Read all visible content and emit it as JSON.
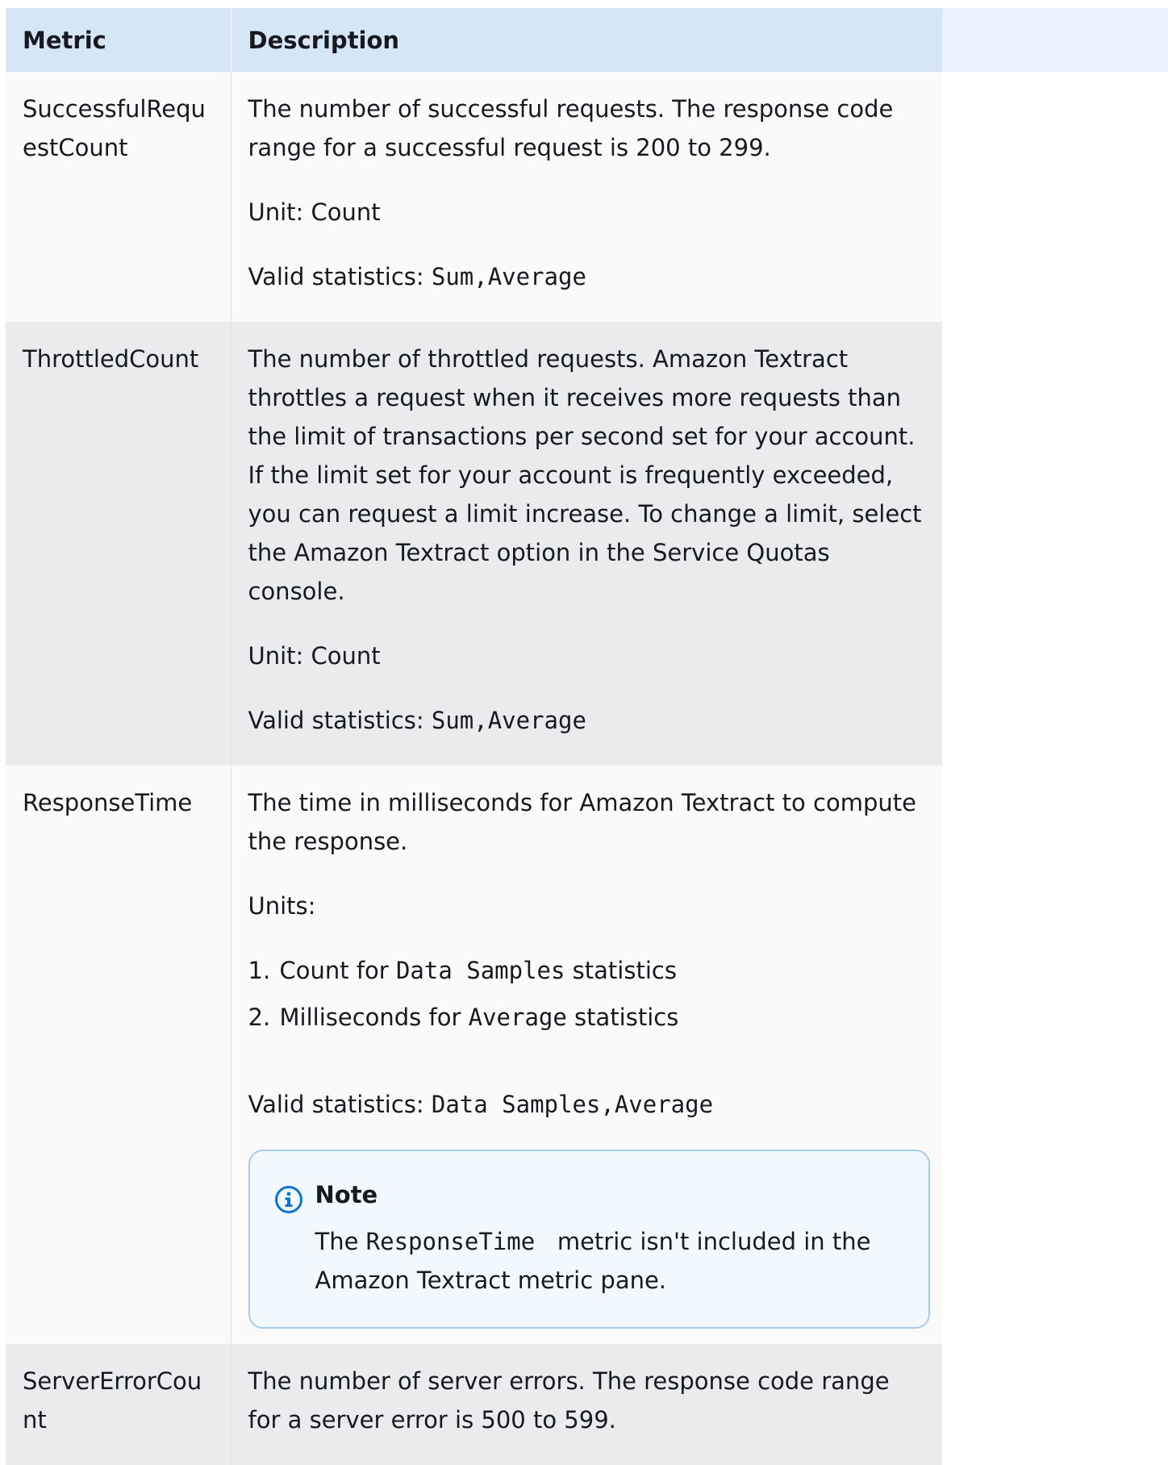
{
  "table": {
    "headers": {
      "metric": "Metric",
      "description": "Description"
    },
    "rows": [
      {
        "metric": "SuccessfulRequestCount",
        "description": "The number of successful requests. The response code range for a successful request is 200 to 299.",
        "unit": "Unit: Count",
        "valid_stats_label": "Valid statistics:",
        "valid_stats_code": "Sum,Average"
      },
      {
        "metric": "ThrottledCount",
        "description": "The number of throttled requests. Amazon Textract throttles a request when it receives more requests than the limit of transactions per second set for your account. If the limit set for your account is frequently exceeded, you can request a limit increase. To change a limit, select the Amazon Textract option in the Service Quotas console.",
        "unit": "Unit: Count",
        "valid_stats_label": "Valid statistics:",
        "valid_stats_code": "Sum,Average"
      },
      {
        "metric": "ResponseTime",
        "description": "The time in milliseconds for Amazon Textract to compute the response.",
        "units_label": "Units:",
        "units_items": [
          {
            "num": "1.",
            "before": "Count for",
            "code": "Data Samples",
            "after": "statistics"
          },
          {
            "num": "2.",
            "before": "Milliseconds for",
            "code": "Average",
            "after": "statistics"
          }
        ],
        "valid_stats_label": "Valid statistics:",
        "valid_stats_code": "Data Samples,Average",
        "note": {
          "title": "Note",
          "before": "The",
          "code": "ResponseTime",
          "after": "metric isn't included in the Amazon Textract metric pane."
        }
      },
      {
        "metric": "ServerErrorCount",
        "description": "The number of server errors. The response code range for a server error is 500 to 599."
      }
    ]
  },
  "colors": {
    "header_bg": "#d5e6f7",
    "row_even_bg": "#eaebed",
    "row_odd_bg": "#fafafa",
    "note_border": "#a8cbeb",
    "note_bg": "#f1f8fe",
    "info_icon": "#0972d3"
  },
  "icons": {
    "note_icon": "info-circle-icon"
  }
}
